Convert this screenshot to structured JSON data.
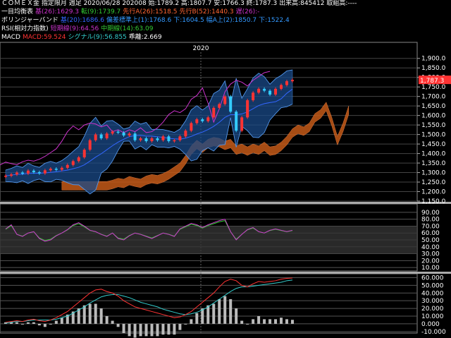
{
  "header": {
    "line1": "ＣＯＭＥＸ金 指定限月 週足 2020/06/28 202008 始:1789.2 高:1807.7 安:1766.3 終:1787.3 出来高:845412 取組高:----",
    "ma": {
      "title": "一目均衡表",
      "kijun": "基(26):1629.3",
      "tenkan": "転(9):1739.7",
      "senkouA": "先行A(26):1518.5",
      "senkouB": "先行B(52):1440.3",
      "chikou": "遅(26):-"
    },
    "bb": {
      "title": "ボリンジャーバンド",
      "mid": "基(20):1686.6",
      "lower1": "偏差標準上(1):1768.6",
      "lower1b": "下:1604.5",
      "upper2": "幅A上(2):1850.7",
      "lower2": "下:1522.4"
    },
    "rsi": {
      "title": "RSI(相対力指数)",
      "short": "短期線(9):64.56",
      "mid": "中期線(14):63.09"
    },
    "macd": {
      "title": "MACD",
      "macd": "MACD:59.524",
      "signal": "シグナル(9):56.855",
      "hist": "乖離:2.669"
    }
  },
  "colors": {
    "kijun": "#cc33cc",
    "tenkan": "#33cc33",
    "senkouA": "#ff6633",
    "senkouB": "#ff6633",
    "chikou": "#cc33cc",
    "bbmid": "#3366ff",
    "up": "#ff3333",
    "down": "#33ccff",
    "macd": "#ff3333",
    "signal": "#33cccc",
    "band": "#1a4a88",
    "cloud": "#c45a18"
  },
  "year_label": "2020",
  "price_label": "1,787.3",
  "price_axis": [
    "1,900.0",
    "1,850.0",
    "1,800.0",
    "1,750.0",
    "1,700.0",
    "1,650.0",
    "1,600.0",
    "1,550.0",
    "1,500.0",
    "1,450.0",
    "1,400.0",
    "1,350.0",
    "1,300.0",
    "1,250.0",
    "1,200.0",
    "1,150.0"
  ],
  "rsi_axis": [
    "90.00",
    "80.00",
    "70.00",
    "60.00",
    "50.00",
    "40.00",
    "30.00",
    "20.00",
    "10.00"
  ],
  "macd_axis": [
    "60.000",
    "50.000",
    "40.000",
    "30.000",
    "20.000",
    "10.000",
    "0.000",
    "-10.000"
  ],
  "chart_data": {
    "type": "line",
    "price_ylim": [
      1150,
      1925
    ],
    "weeks": 52,
    "close": [
      1283,
      1290,
      1300,
      1295,
      1310,
      1302,
      1296,
      1312,
      1320,
      1315,
      1325,
      1340,
      1360,
      1380,
      1420,
      1470,
      1500,
      1480,
      1505,
      1515,
      1510,
      1495,
      1505,
      1470,
      1480,
      1465,
      1480,
      1470,
      1490,
      1465,
      1470,
      1490,
      1520,
      1560,
      1580,
      1570,
      1590,
      1640,
      1660,
      1700,
      1620,
      1520,
      1590,
      1680,
      1720,
      1740,
      1730,
      1710,
      1740,
      1760,
      1780,
      1787
    ],
    "rsi_short": [
      66,
      72,
      58,
      55,
      60,
      62,
      52,
      48,
      50,
      56,
      60,
      65,
      72,
      75,
      70,
      64,
      62,
      58,
      55,
      60,
      52,
      50,
      56,
      60,
      58,
      55,
      52,
      56,
      60,
      58,
      55,
      66,
      70,
      74,
      72,
      68,
      72,
      75,
      78,
      80,
      62,
      50,
      58,
      65,
      68,
      62,
      60,
      64,
      66,
      64,
      62,
      64
    ],
    "macd": [
      2,
      3,
      4,
      3,
      5,
      6,
      4,
      3,
      5,
      8,
      12,
      16,
      22,
      28,
      34,
      40,
      44,
      45,
      42,
      40,
      36,
      30,
      26,
      22,
      20,
      18,
      16,
      14,
      12,
      10,
      8,
      9,
      12,
      16,
      22,
      28,
      34,
      40,
      48,
      55,
      58,
      56,
      50,
      48,
      52,
      55,
      54,
      55,
      56,
      58,
      59,
      59.5
    ],
    "signal": [
      1,
      2,
      3,
      3,
      4,
      5,
      5,
      5,
      5,
      6,
      8,
      10,
      14,
      18,
      22,
      27,
      31,
      35,
      37,
      38,
      38,
      36,
      34,
      31,
      28,
      26,
      24,
      22,
      19,
      17,
      15,
      13,
      12,
      13,
      15,
      18,
      22,
      27,
      32,
      37,
      42,
      46,
      48,
      48,
      49,
      50,
      51,
      52,
      53,
      54,
      56,
      56.9
    ]
  }
}
